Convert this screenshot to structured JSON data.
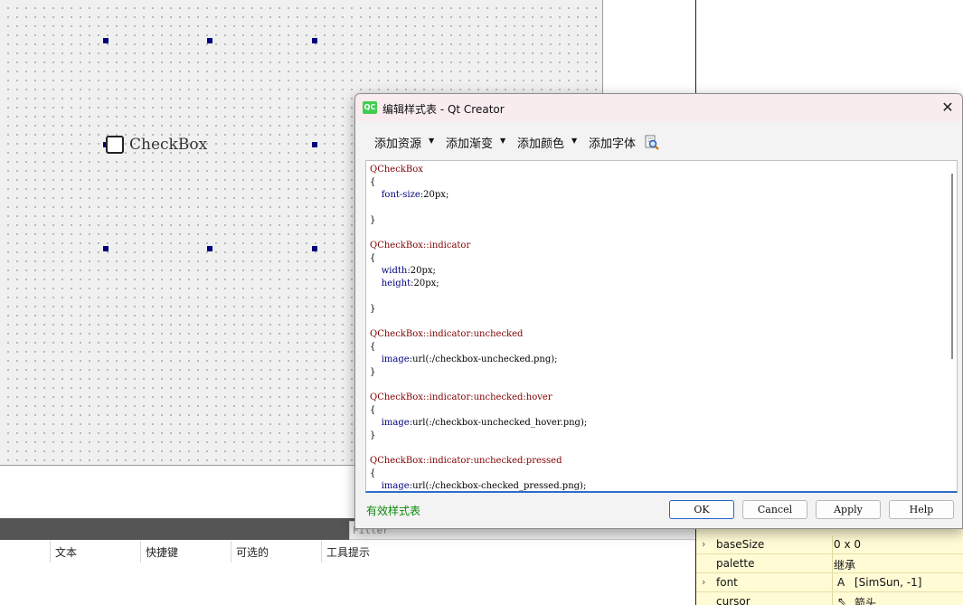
{
  "designer": {
    "checkbox_label": "CheckBox",
    "filter_placeholder": "Filter"
  },
  "action_editor": {
    "columns": [
      "文本",
      "快捷键",
      "可选的",
      "工具提示"
    ]
  },
  "properties": [
    {
      "name": "baseSize",
      "value": "0 x 0",
      "expandable": true
    },
    {
      "name": "palette",
      "value": "继承",
      "expandable": false
    },
    {
      "name": "font",
      "value": "[SimSun, -1]",
      "expandable": true
    },
    {
      "name": "cursor",
      "value": "箭头",
      "expandable": false
    }
  ],
  "dialog": {
    "title": "编辑样式表 - Qt Creator",
    "app_icon": "QC",
    "toolbar": {
      "add_resource": "添加资源",
      "add_gradient": "添加渐变",
      "add_color": "添加颜色",
      "add_font": "添加字体"
    },
    "code_lines": [
      {
        "sel": "QCheckBox"
      },
      {
        "t": "{"
      },
      {
        "p": "font-size",
        "v": "20px;"
      },
      {
        "t": ""
      },
      {
        "t": "}"
      },
      {
        "t": ""
      },
      {
        "sel": "QCheckBox::indicator"
      },
      {
        "t": "{"
      },
      {
        "p": "width",
        "v": "20px;"
      },
      {
        "p": "height",
        "v": "20px;"
      },
      {
        "t": ""
      },
      {
        "t": "}"
      },
      {
        "t": ""
      },
      {
        "sel": "QCheckBox::indicator:unchecked"
      },
      {
        "t": "{"
      },
      {
        "p": "image",
        "v": "url(:/checkbox-unchecked.png);"
      },
      {
        "t": "}"
      },
      {
        "t": ""
      },
      {
        "sel": "QCheckBox::indicator:unchecked:hover"
      },
      {
        "t": "{"
      },
      {
        "p": "image",
        "v": "url(:/checkbox-unchecked_hover.png);"
      },
      {
        "t": "}"
      },
      {
        "t": ""
      },
      {
        "sel": "QCheckBox::indicator:unchecked:pressed"
      },
      {
        "t": "{"
      },
      {
        "p": "image",
        "v": "url(:/checkbox-checked_pressed.png);"
      }
    ],
    "status": "有效样式表",
    "buttons": {
      "ok": "OK",
      "cancel": "Cancel",
      "apply": "Apply",
      "help": "Help"
    }
  },
  "colors": {
    "valid_status": "#0a8a0a",
    "selector": "#800000",
    "property": "#000080",
    "accent": "#2c6fc8"
  }
}
